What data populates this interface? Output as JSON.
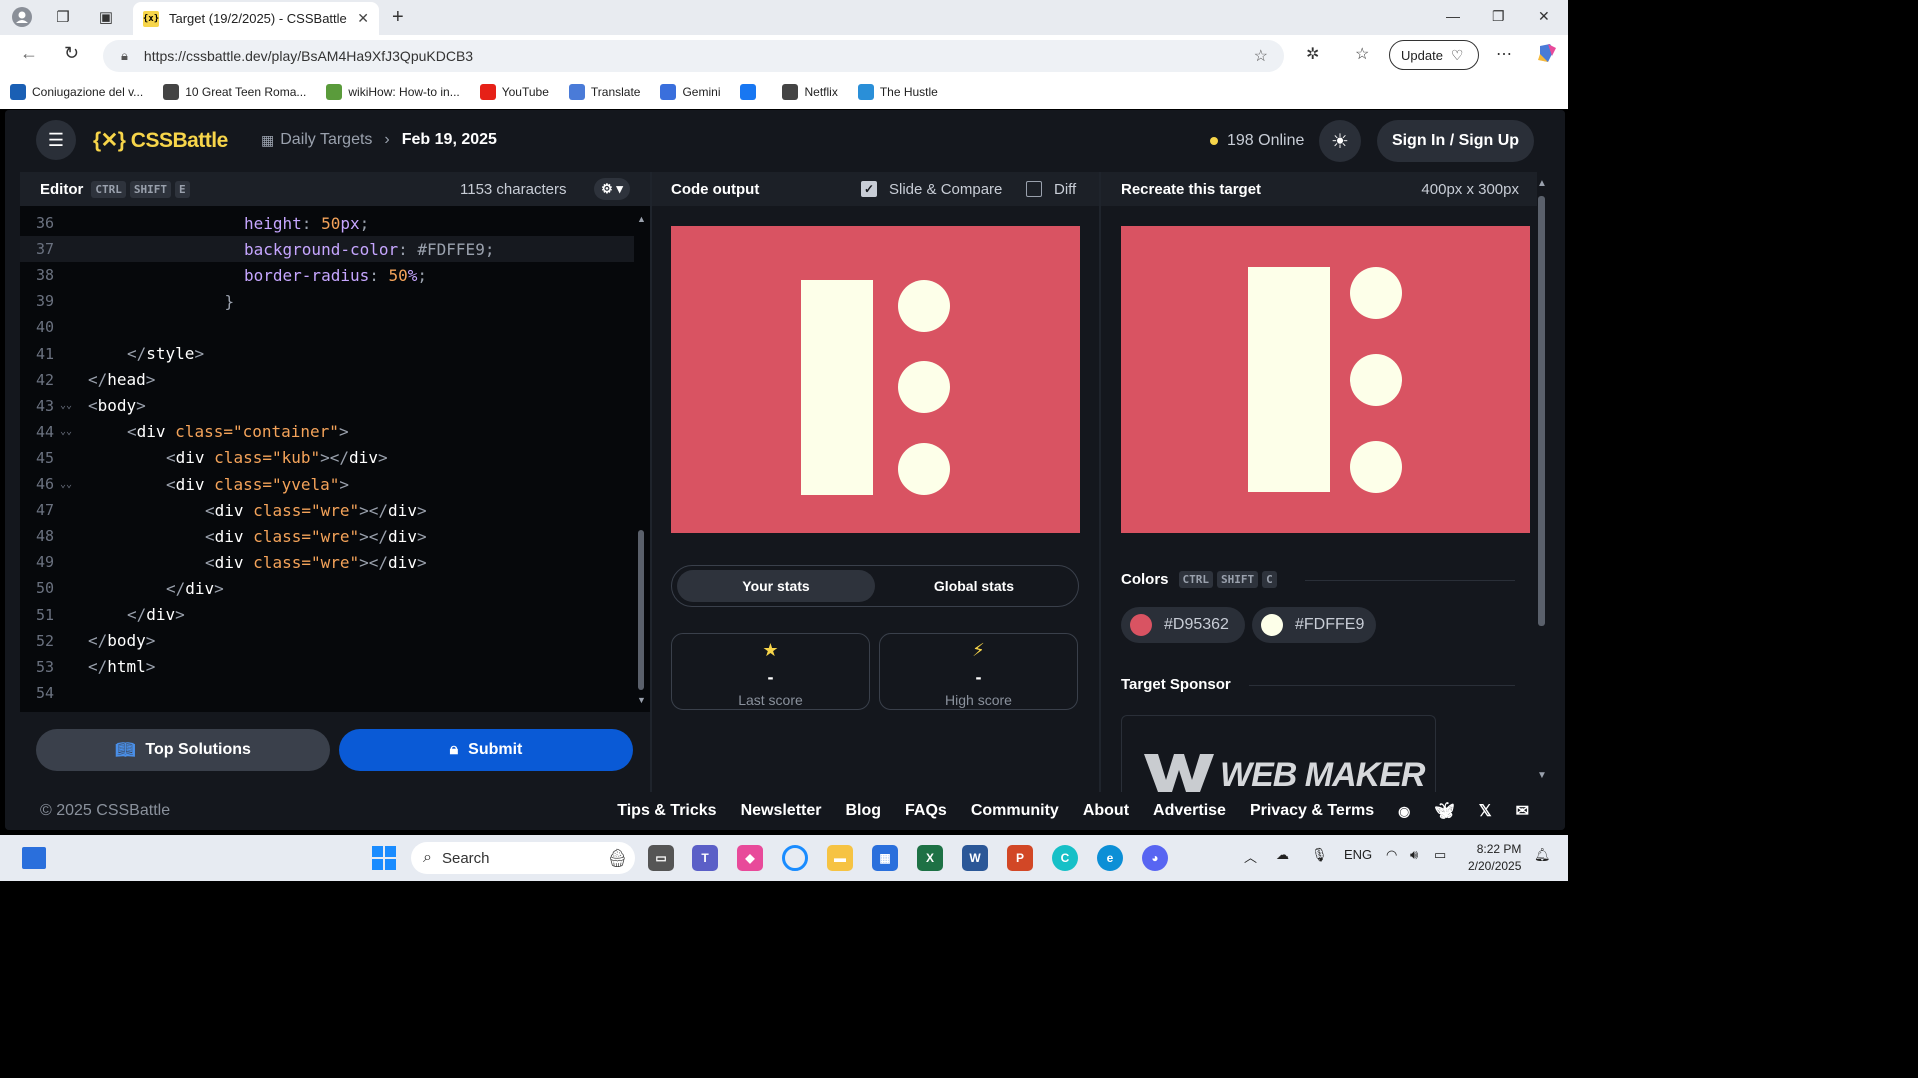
{
  "browser": {
    "tab_title": "Target (19/2/2025) - CSSBattle",
    "url": "https://cssbattle.dev/play/BsAM4Ha9XfJ3QpuKDCB3",
    "update_label": "Update",
    "bookmarks": [
      {
        "label": "Coniugazione del v...",
        "icon": "cj",
        "color": "#1a5fb4"
      },
      {
        "label": "10 Great Teen Roma...",
        "icon": "owl",
        "color": "#444444"
      },
      {
        "label": "wikiHow: How-to in...",
        "icon": "wh",
        "color": "#5a9b3b"
      },
      {
        "label": "YouTube",
        "icon": "yt",
        "color": "#e62117"
      },
      {
        "label": "Translate",
        "icon": "gt",
        "color": "#4a7bd8"
      },
      {
        "label": "Gemini",
        "icon": "gem",
        "color": "#3a6fdc"
      },
      {
        "label": "",
        "icon": "fb",
        "color": "#1877f2"
      },
      {
        "label": "Netflix",
        "icon": "folder",
        "color": "#444444"
      },
      {
        "label": "The Hustle",
        "icon": "hustle",
        "color": "#2a8fd8"
      }
    ]
  },
  "app": {
    "logo": "{✕} CSSBattle",
    "breadcrumb": {
      "parent": "Daily Targets",
      "current": "Feb 19, 2025"
    },
    "online": "198 Online",
    "signin_label": "Sign In / Sign Up",
    "editor": {
      "title": "Editor",
      "keys": [
        "CTRL",
        "SHIFT",
        "E"
      ],
      "char_count": "1153 characters"
    },
    "output": {
      "title": "Code output",
      "slide_label": "Slide & Compare",
      "diff_label": "Diff"
    },
    "target": {
      "title": "Recreate this target",
      "size": "400px x 300px"
    },
    "code_lines": [
      {
        "n": "36",
        "html": "<span class='prop'>height</span><span class='punc'>: </span><span class='num'>50</span><span class='prop'>px</span><span class='punc'>;</span>",
        "indent": 4
      },
      {
        "n": "37",
        "html": "<span class='prop'>background-color</span><span class='punc'>: </span><span class='hex'>#FDFFE9</span><span class='punc'>;</span>",
        "indent": 4,
        "active": true
      },
      {
        "n": "38",
        "html": "<span class='prop'>border-radius</span><span class='punc'>: </span><span class='num'>50</span><span class='prop'>%</span><span class='punc'>;</span>",
        "indent": 4
      },
      {
        "n": "39",
        "html": "<span class='punc'>}</span>",
        "indent": 3.5
      },
      {
        "n": "40",
        "html": "",
        "indent": 0
      },
      {
        "n": "41",
        "html": "<span class='punc'>&lt;/</span><span class='tag'>style</span><span class='punc'>&gt;</span>",
        "indent": 1
      },
      {
        "n": "42",
        "html": "<span class='punc'>&lt;/</span><span class='tag'>head</span><span class='punc'>&gt;</span>",
        "indent": 0
      },
      {
        "n": "43",
        "html": "<span class='punc'>&lt;</span><span class='tag'>body</span><span class='punc'>&gt;</span>",
        "indent": 0,
        "fold": true
      },
      {
        "n": "44",
        "html": "<span class='punc'>&lt;</span><span class='tag'>div </span><span class='str'>class=\"container\"</span><span class='punc'>&gt;</span>",
        "indent": 1,
        "fold": true
      },
      {
        "n": "45",
        "html": "<span class='punc'>&lt;</span><span class='tag'>div </span><span class='str'>class=\"kub\"</span><span class='punc'>&gt;&lt;/</span><span class='tag'>div</span><span class='punc'>&gt;</span>",
        "indent": 2
      },
      {
        "n": "46",
        "html": "<span class='punc'>&lt;</span><span class='tag'>div </span><span class='str'>class=\"yvela\"</span><span class='punc'>&gt;</span>",
        "indent": 2,
        "fold": true
      },
      {
        "n": "47",
        "html": "<span class='punc'>&lt;</span><span class='tag'>div </span><span class='str'>class=\"wre\"</span><span class='punc'>&gt;&lt;/</span><span class='tag'>div</span><span class='punc'>&gt;</span>",
        "indent": 3
      },
      {
        "n": "48",
        "html": "<span class='punc'>&lt;</span><span class='tag'>div </span><span class='str'>class=\"wre\"</span><span class='punc'>&gt;&lt;/</span><span class='tag'>div</span><span class='punc'>&gt;</span>",
        "indent": 3
      },
      {
        "n": "49",
        "html": "<span class='punc'>&lt;</span><span class='tag'>div </span><span class='str'>class=\"wre\"</span><span class='punc'>&gt;&lt;/</span><span class='tag'>div</span><span class='punc'>&gt;</span>",
        "indent": 3
      },
      {
        "n": "50",
        "html": "<span class='punc'>&lt;/</span><span class='tag'>div</span><span class='punc'>&gt;</span>",
        "indent": 2
      },
      {
        "n": "51",
        "html": "<span class='punc'>&lt;/</span><span class='tag'>div</span><span class='punc'>&gt;</span>",
        "indent": 1
      },
      {
        "n": "52",
        "html": "<span class='punc'>&lt;/</span><span class='tag'>body</span><span class='punc'>&gt;</span>",
        "indent": 0
      },
      {
        "n": "53",
        "html": "<span class='punc'>&lt;/</span><span class='tag'>html</span><span class='punc'>&gt;</span>",
        "indent": 0
      },
      {
        "n": "54",
        "html": "",
        "indent": 0
      }
    ],
    "buttons": {
      "top_solutions": "Top Solutions",
      "submit": "Submit"
    },
    "stats": {
      "tabs": [
        "Your stats",
        "Global stats"
      ],
      "last_score": {
        "value": "-",
        "label": "Last score"
      },
      "high_score": {
        "value": "-",
        "label": "High score"
      }
    },
    "colors": {
      "title": "Colors",
      "keys": [
        "CTRL",
        "SHIFT",
        "C"
      ],
      "swatches": [
        {
          "hex": "#D95362"
        },
        {
          "hex": "#FDFFE9"
        }
      ]
    },
    "sponsor": {
      "title": "Target Sponsor"
    },
    "footer": {
      "copyright": "© 2025 CSSBattle",
      "links": [
        "Tips & Tricks",
        "Newsletter",
        "Blog",
        "FAQs",
        "Community",
        "About",
        "Advertise",
        "Privacy & Terms"
      ]
    }
  },
  "taskbar": {
    "search": "Search",
    "lang": "ENG",
    "time": "8:22 PM",
    "date": "2/20/2025"
  }
}
